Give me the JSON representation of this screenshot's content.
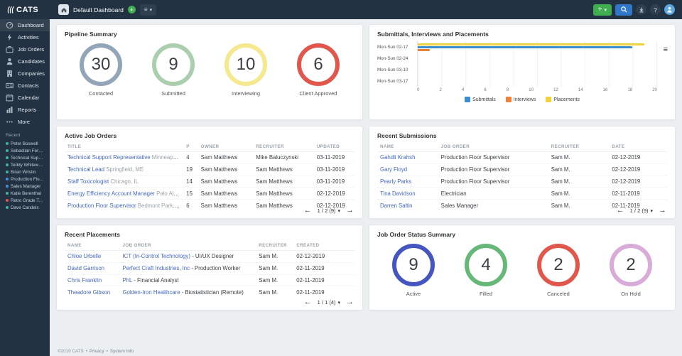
{
  "topbar": {
    "logo": "CATS",
    "dashboard_label": "Default Dashboard",
    "icon_names": [
      "home-icon",
      "add-dashboard-icon",
      "hamburger-icon",
      "caret-down-icon",
      "plus-icon",
      "search-icon",
      "download-icon",
      "help-icon",
      "user-avatar"
    ],
    "help_label": "?",
    "accent_green": "#3fae4f",
    "accent_blue": "#3076c9"
  },
  "sidebar": {
    "items": [
      {
        "label": "Dashboard",
        "icon": "dashboard-icon",
        "active": true
      },
      {
        "label": "Activities",
        "icon": "activities-icon"
      },
      {
        "label": "Job Orders",
        "icon": "job-orders-icon"
      },
      {
        "label": "Candidates",
        "icon": "candidates-icon"
      },
      {
        "label": "Companies",
        "icon": "companies-icon"
      },
      {
        "label": "Contacts",
        "icon": "contacts-icon"
      },
      {
        "label": "Calendar",
        "icon": "calendar-icon"
      },
      {
        "label": "Reports",
        "icon": "reports-icon"
      },
      {
        "label": "More",
        "icon": "more-icon"
      }
    ],
    "recent_label": "Recent",
    "recent": [
      {
        "name": "Peter Boswell",
        "color": "#43b59a"
      },
      {
        "name": "Sebastian Ferraro",
        "color": "#43b59a"
      },
      {
        "name": "Technical Support ...",
        "color": "#43b59a"
      },
      {
        "name": "Teddy Whitewater",
        "color": "#43b59a"
      },
      {
        "name": "Brian Wristin",
        "color": "#43b59a"
      },
      {
        "name": "Production Floor ...",
        "color": "#4a90d9"
      },
      {
        "name": "Sales Manager",
        "color": "#4a90d9"
      },
      {
        "name": "Katie Berenthal",
        "color": "#43b59a"
      },
      {
        "name": "Retro Grade Techn...",
        "color": "#e2574c"
      },
      {
        "name": "Dave Candels",
        "color": "#43b59a"
      }
    ]
  },
  "pipeline": {
    "title": "Pipeline Summary",
    "metrics": [
      {
        "value": "30",
        "label": "Contacted",
        "color": "#93a5b8"
      },
      {
        "value": "9",
        "label": "Submitted",
        "color": "#abcfae"
      },
      {
        "value": "10",
        "label": "Interviewing",
        "color": "#f6e88e"
      },
      {
        "value": "6",
        "label": "Client Approved",
        "color": "#e2574c"
      }
    ]
  },
  "chart_data": {
    "type": "bar",
    "orientation": "horizontal",
    "title": "Submittals, Interviews and Placements",
    "categories": [
      "Mon-Sun 02-17",
      "Mon-Sun 02-24",
      "Mon-Sun 03-10",
      "Mon-Sun 03-17"
    ],
    "series": [
      {
        "name": "Submittals",
        "color": "#3d8fd1",
        "values": [
          18,
          0,
          0,
          0
        ]
      },
      {
        "name": "Interviews",
        "color": "#e8833c",
        "values": [
          1,
          0,
          0,
          0
        ]
      },
      {
        "name": "Placements",
        "color": "#f0d23c",
        "values": [
          19,
          0,
          0,
          0
        ]
      }
    ],
    "xlim": [
      0,
      20
    ],
    "xticks": [
      0,
      2,
      4,
      6,
      8,
      10,
      12,
      14,
      16,
      18,
      20
    ],
    "grid": true,
    "legend_position": "bottom"
  },
  "active_job_orders": {
    "title": "Active Job Orders",
    "headers": [
      "Title",
      "P",
      "Owner",
      "Recruiter",
      "Updated"
    ],
    "rows": [
      [
        {
          "link": "Technical Support Representative",
          "muted": " Minneapolis"
        },
        "4",
        "Sam Matthews",
        "Mike Baluczynski",
        "03-11-2019"
      ],
      [
        {
          "link": "Technical Lead",
          "muted": " Springfield, ME"
        },
        "19",
        "Sam Matthews",
        "Sam Matthews",
        "03-11-2019"
      ],
      [
        {
          "link": "Staff Toxicologist",
          "muted": " Chicago, IL"
        },
        "14",
        "Sam Matthews",
        "Sam Matthews",
        "03-11-2019"
      ],
      [
        {
          "link": "Energy Efficiency Account Manager",
          "muted": " Palo Alto, CA"
        },
        "15",
        "Sam Matthews",
        "Sam Matthews",
        "02-12-2019"
      ],
      [
        {
          "link": "Production Floor Supervisor",
          "muted": " Bedmont Park, CA"
        },
        "6",
        "Sam Matthews",
        "Sam Matthews",
        "02-12-2019"
      ]
    ],
    "pagination": "1 / 2 (9)"
  },
  "recent_submissions": {
    "title": "Recent Submissions",
    "headers": [
      "Name",
      "Job Order",
      "Recruiter",
      "Date"
    ],
    "rows": [
      [
        {
          "link": "Gahdli Krahsh"
        },
        "Production Floor Supervisor",
        "Sam M.",
        "02-12-2019"
      ],
      [
        {
          "link": "Gary Floyd"
        },
        "Production Floor Supervisor",
        "Sam M.",
        "02-12-2019"
      ],
      [
        {
          "link": "Pearly Parks"
        },
        "Production Floor Supervisor",
        "Sam M.",
        "02-12-2019"
      ],
      [
        {
          "link": "Tina Davidson"
        },
        "Electrician",
        "Sam M.",
        "02-11-2019"
      ],
      [
        {
          "link": "Darren Saltin"
        },
        "Sales Manager",
        "Sam M.",
        "02-11-2019"
      ]
    ],
    "pagination": "1 / 2 (9)"
  },
  "recent_placements": {
    "title": "Recent Placements",
    "headers": [
      "Name",
      "Job Order",
      "Recruiter",
      "Created"
    ],
    "rows": [
      [
        {
          "link": "Chloe Urbelle"
        },
        {
          "link": "ICT (In-Control Technology)",
          "text": " - UI/UX Designer"
        },
        "Sam M.",
        "02-12-2019"
      ],
      [
        {
          "link": "David Garrison"
        },
        {
          "link": "Perfect Craft Industries, Inc",
          "text": " - Production Worker"
        },
        "Sam M.",
        "02-11-2019"
      ],
      [
        {
          "link": "Chris Franklin"
        },
        {
          "link": "PhL",
          "text": " - Financial Analyst"
        },
        "Sam M.",
        "02-11-2019"
      ],
      [
        {
          "link": "Theadore Gibson"
        },
        {
          "link": "Golden-Iron Healthcare",
          "text": " - Biostatistician (Remote)"
        },
        "Sam M.",
        "02-11-2019"
      ]
    ],
    "pagination": "1 / 1 (4)"
  },
  "job_order_status": {
    "title": "Job Order Status Summary",
    "metrics": [
      {
        "value": "9",
        "label": "Active",
        "color": "#4656c0"
      },
      {
        "value": "4",
        "label": "Filled",
        "color": "#66b878"
      },
      {
        "value": "2",
        "label": "Canceled",
        "color": "#e2574c"
      },
      {
        "value": "2",
        "label": "On Hold",
        "color": "#d8abd8"
      }
    ]
  },
  "footer": {
    "copyright": "©2019 CATS",
    "sep": "•",
    "privacy": "Privacy",
    "system_info": "System Info"
  }
}
